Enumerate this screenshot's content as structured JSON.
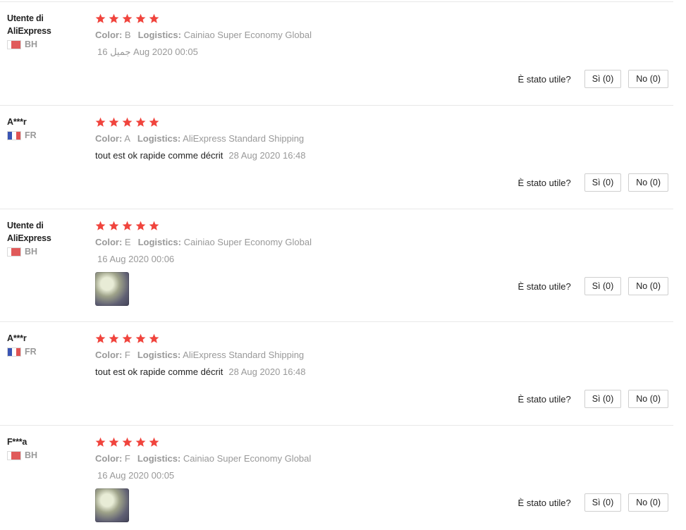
{
  "labels": {
    "color_key": "Color:",
    "logistics_key": "Logistics:",
    "helpful_question": "È stato utile?"
  },
  "rating_color": "#f0443d",
  "reviews": [
    {
      "user": "Utente di AliExpress",
      "country": "BH",
      "flag": "bh",
      "stars": 5,
      "color": "B",
      "logistics": "Cainiao Super Economy Global",
      "text": "",
      "date": "جميل 16 Aug 2020 00:05",
      "has_photo": false,
      "yes": "Sì (0)",
      "no": "No (0)"
    },
    {
      "user": "A***r",
      "country": "FR",
      "flag": "fr",
      "stars": 5,
      "color": "A",
      "logistics": "AliExpress Standard Shipping",
      "text": "tout est ok rapide comme décrit",
      "date": "28 Aug 2020 16:48",
      "has_photo": false,
      "yes": "Sì (0)",
      "no": "No (0)"
    },
    {
      "user": "Utente di AliExpress",
      "country": "BH",
      "flag": "bh",
      "stars": 5,
      "color": "E",
      "logistics": "Cainiao Super Economy Global",
      "text": "",
      "date": "16 Aug 2020 00:06",
      "has_photo": true,
      "yes": "Sì (0)",
      "no": "No (0)"
    },
    {
      "user": "A***r",
      "country": "FR",
      "flag": "fr",
      "stars": 5,
      "color": "F",
      "logistics": "AliExpress Standard Shipping",
      "text": "tout est ok rapide comme décrit",
      "date": "28 Aug 2020 16:48",
      "has_photo": false,
      "yes": "Sì (0)",
      "no": "No (0)"
    },
    {
      "user": "F***a",
      "country": "BH",
      "flag": "bh",
      "stars": 5,
      "color": "F",
      "logistics": "Cainiao Super Economy Global",
      "text": "",
      "date": "16 Aug 2020 00:05",
      "has_photo": true,
      "yes": "Sì (0)",
      "no": "No (0)"
    }
  ]
}
